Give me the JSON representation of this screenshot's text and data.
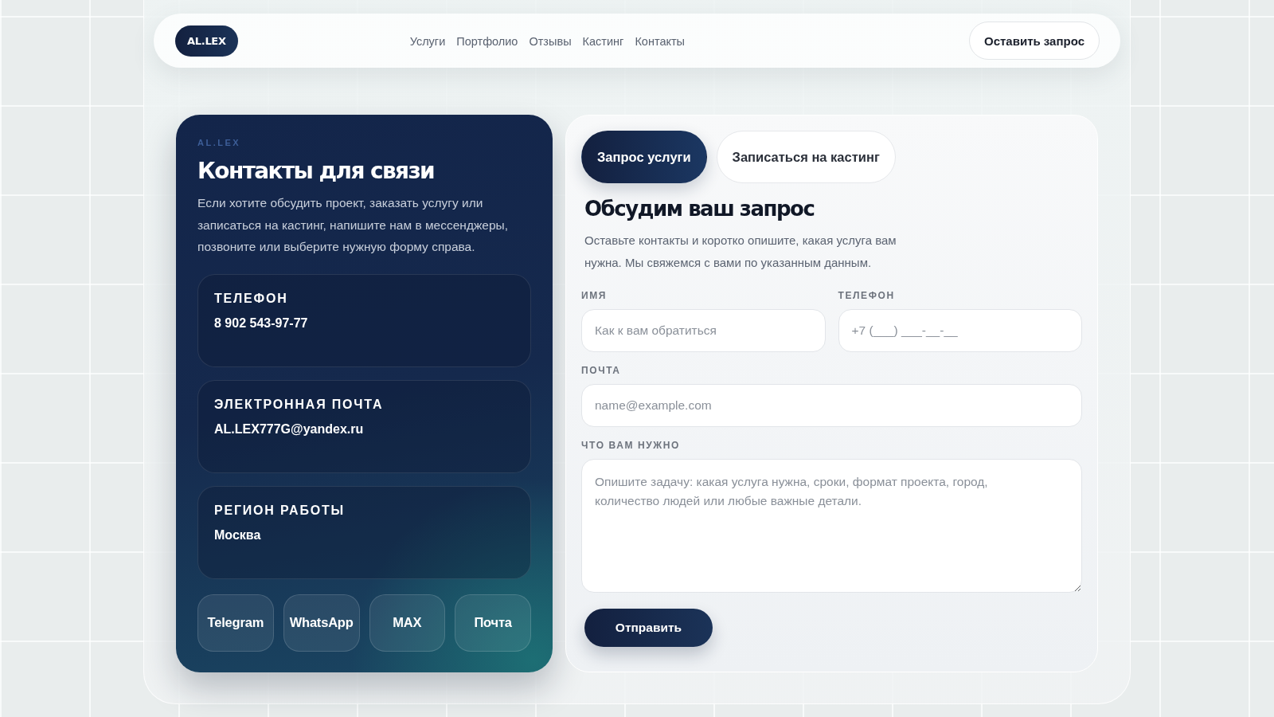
{
  "header": {
    "logo": "AL.LEX",
    "nav": [
      "Услуги",
      "Портфолио",
      "Отзывы",
      "Кастинг",
      "Контакты"
    ],
    "cta": "Оставить запрос"
  },
  "contacts": {
    "eyebrow": "AL.LEX",
    "title": "Контакты для связи",
    "text": "Если хотите обсудить проект, заказать услугу или записаться на кастинг, напишите нам в мессенджеры, позвоните или выберите нужную форму справа.",
    "items": [
      {
        "label": "ТЕЛЕФОН",
        "value": "8 902 543-97-77"
      },
      {
        "label": "ЭЛЕКТРОННАЯ ПОЧТА",
        "value": "AL.LEX777G@yandex.ru"
      },
      {
        "label": "РЕГИОН РАБОТЫ",
        "value": "Москва"
      }
    ],
    "messengers": [
      "Telegram",
      "WhatsApp",
      "MAX",
      "Почта"
    ]
  },
  "form": {
    "tabs": [
      {
        "label": "Запрос услуги",
        "selected": true
      },
      {
        "label": "Записаться на кастинг",
        "selected": false
      }
    ],
    "title": "Обсудим ваш запрос",
    "text": "Оставьте контакты и коротко опишите, какая услуга вам нужна. Мы свяжемся с вами по указанным данным.",
    "rows": [
      [
        {
          "kind": "input",
          "label": "ИМЯ",
          "placeholder": "Как к вам обратиться"
        },
        {
          "kind": "input",
          "label": "ТЕЛЕФОН",
          "placeholder": "+7 (___) ___-__-__"
        }
      ],
      [
        {
          "kind": "input",
          "label": "ПОЧТА",
          "placeholder": "name@example.com"
        }
      ],
      [
        {
          "kind": "textarea",
          "label": "ЧТО ВАМ НУЖНО",
          "placeholder": "Опишите задачу: какая услуга нужна, сроки, формат проекта, город, количество людей или любые важные детали."
        }
      ]
    ],
    "submit": "Отправить"
  }
}
